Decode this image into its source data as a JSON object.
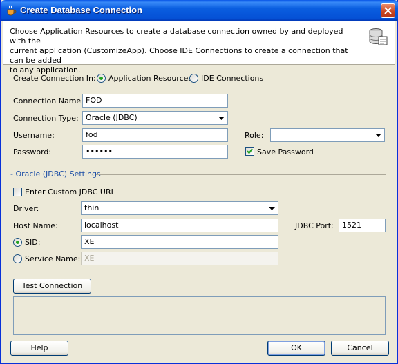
{
  "window": {
    "title": "Create Database Connection",
    "accent": "#0551d6",
    "section_color": "#1d4fa6",
    "icons": {
      "title": "jdeveloper-cup-icon",
      "close": "close-icon",
      "database": "database-wizard-icon"
    }
  },
  "info": {
    "line1": "Choose Application Resources to create a database connection owned by and deployed with the",
    "line2": "current application (CustomizeApp). Choose IDE Connections to create a connection that can be added",
    "line3": "to any application."
  },
  "create_in": {
    "label": "Create Connection In:",
    "options": [
      {
        "label": "Application Resources",
        "checked": true
      },
      {
        "label": "IDE Connections",
        "checked": false
      }
    ]
  },
  "form": {
    "connection_name": {
      "label": "Connection Name:",
      "value": "FOD"
    },
    "connection_type": {
      "label": "Connection Type:",
      "value": "Oracle (JDBC)"
    },
    "username": {
      "label": "Username:",
      "value": "fod"
    },
    "password": {
      "label": "Password:",
      "value": "••••••"
    },
    "role": {
      "label": "Role:",
      "value": ""
    },
    "save_password": {
      "label": "Save Password",
      "checked": true
    }
  },
  "oracle": {
    "section_title": "- Oracle (JDBC) Settings",
    "custom_url": {
      "label": "Enter Custom JDBC URL",
      "checked": false
    },
    "driver": {
      "label": "Driver:",
      "value": "thin"
    },
    "host": {
      "label": "Host Name:",
      "value": "localhost"
    },
    "port": {
      "label": "JDBC Port:",
      "value": "1521"
    },
    "sid": {
      "label": "SID:",
      "value": "XE",
      "checked": true
    },
    "service_name": {
      "label": "Service Name:",
      "value": "XE",
      "checked": false
    }
  },
  "buttons": {
    "test": "Test Connection",
    "help": "Help",
    "ok": "OK",
    "cancel": "Cancel"
  }
}
